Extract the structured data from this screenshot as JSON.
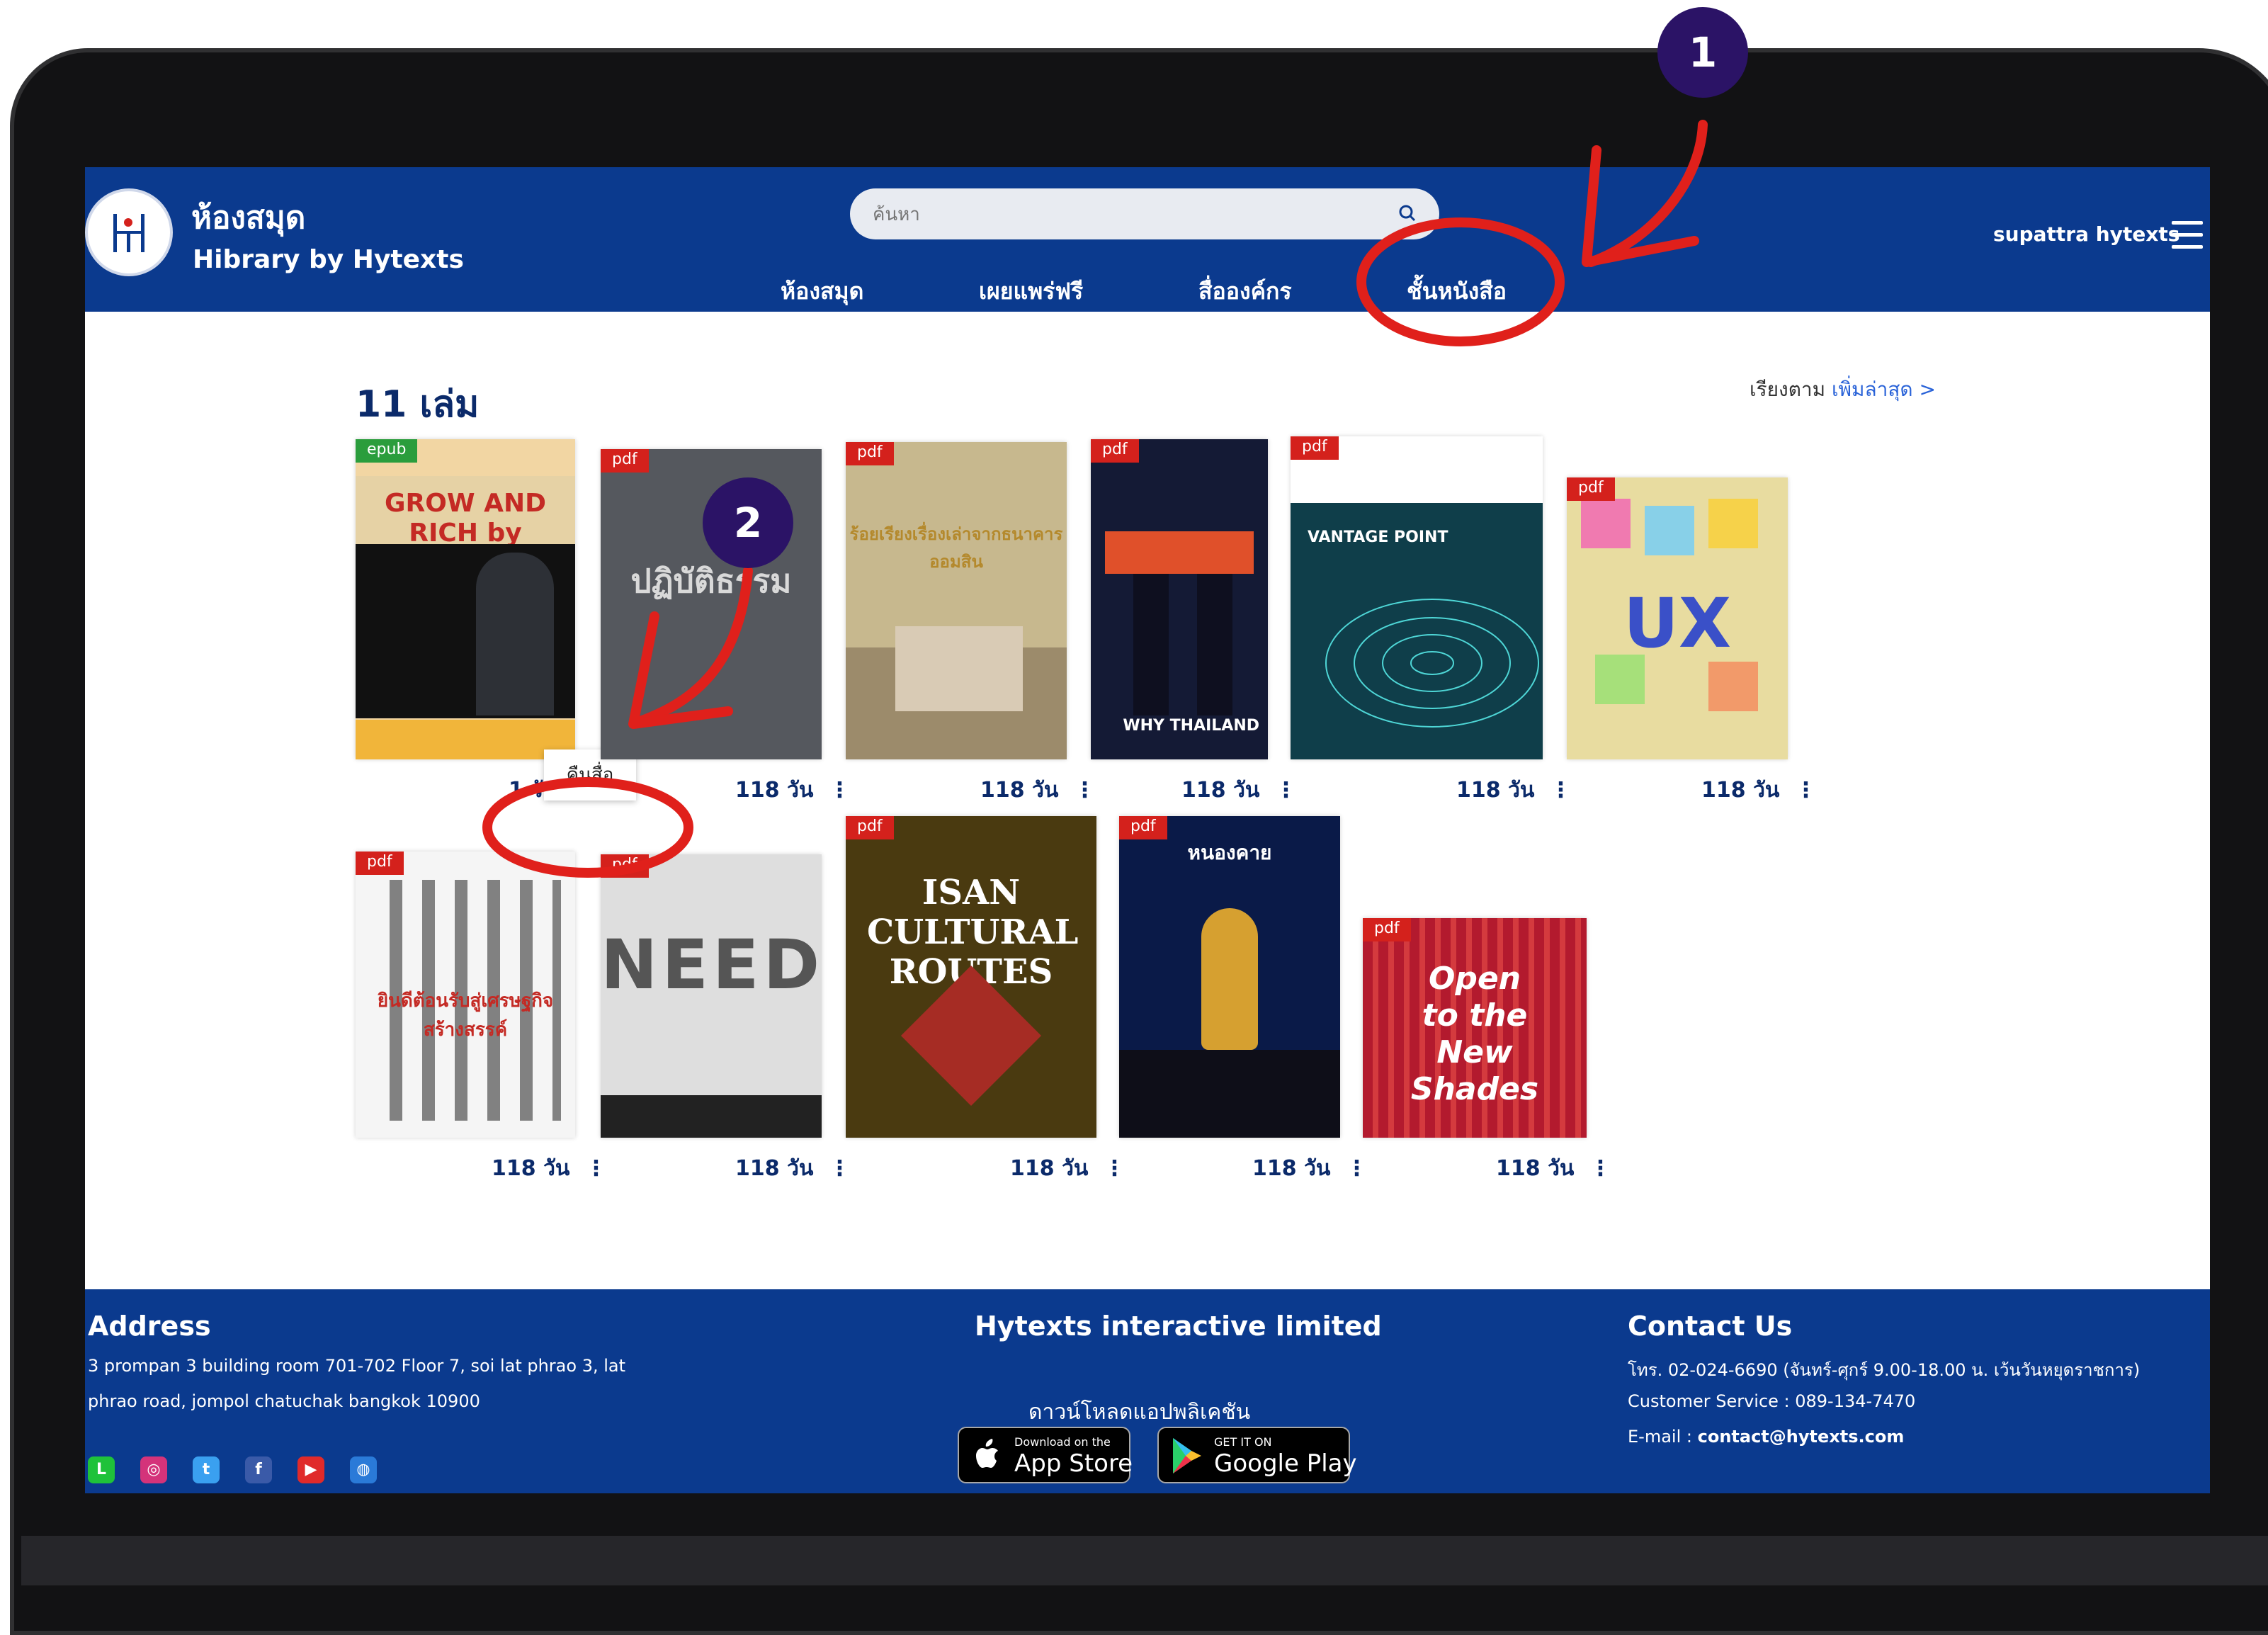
{
  "header": {
    "brand_name": "ห้องสมุด",
    "brand_sub": "Hibrary by Hytexts",
    "search_placeholder": "ค้นหา",
    "nav": [
      "ห้องสมุด",
      "เผยแพร่ฟรี",
      "สื่อองค์กร",
      "ชั้นหนังสือ"
    ],
    "active_nav": "ชั้นหนังสือ",
    "user_name": "supattra hytexts"
  },
  "shelf": {
    "count_title": "11 เล่ม",
    "sort_label": "เรียงตาม",
    "sort_value": "เพิ่มล่าสุด >",
    "context_menu_item": "คืนสื่อ",
    "books": [
      {
        "format": "epub",
        "cover_text": "GROW AND RICH by DHAMMA",
        "remaining": "1 วัน"
      },
      {
        "format": "pdf",
        "cover_text": "ปฏิบัติธรรม",
        "remaining": "118 วัน"
      },
      {
        "format": "pdf",
        "cover_text": "ร้อยเรียงเรื่องเล่าจากธนาคารออมสิน",
        "remaining": "118 วัน"
      },
      {
        "format": "pdf",
        "cover_text": "WHY THAILAND",
        "remaining": "118 วัน"
      },
      {
        "format": "pdf",
        "cover_text": "VANTAGE POINT",
        "remaining": "118 วัน"
      },
      {
        "format": "pdf",
        "cover_text": "UX",
        "remaining": "118 วัน"
      },
      {
        "format": "pdf",
        "cover_text": "ยินดีต้อนรับสู่เศรษฐกิจสร้างสรรค์",
        "remaining": "118 วัน"
      },
      {
        "format": "pdf",
        "cover_text": "NEEDS",
        "remaining": "118 วัน"
      },
      {
        "format": "pdf",
        "cover_text": "ISAN CULTURAL ROUTES",
        "remaining": "118 วัน"
      },
      {
        "format": "pdf",
        "cover_text": "หนองคาย",
        "remaining": "118 วัน"
      },
      {
        "format": "pdf",
        "cover_text": "Open to the New Shades",
        "remaining": "118 วัน"
      }
    ]
  },
  "footer": {
    "address_title": "Address",
    "address_line1": "3 prompan 3 building room 701-702 Floor 7, soi lat phrao 3, lat",
    "address_line2": "phrao road, jompol chatuchak bangkok 10900",
    "company": "Hytexts interactive limited",
    "download_label": "ดาวน์โหลดแอปพลิเคชัน",
    "app_store_small": "Download on the",
    "app_store_big": "App Store",
    "google_small": "GET IT ON",
    "google_big": "Google Play",
    "contact_title": "Contact Us",
    "phone": "โทร. 02-024-6690 (จันทร์-ศุกร์ 9.00-18.00 น. เว้นวันหยุดราชการ)",
    "customer_service": "Customer Service : 089-134-7470",
    "email_label": "E-mail :",
    "email": "contact@hytexts.com"
  },
  "annotations": {
    "marker_1": "1",
    "marker_2": "2"
  },
  "colors": {
    "header": "#0b3a8e",
    "accent_red": "#e0201b",
    "marker": "#2b1366"
  }
}
